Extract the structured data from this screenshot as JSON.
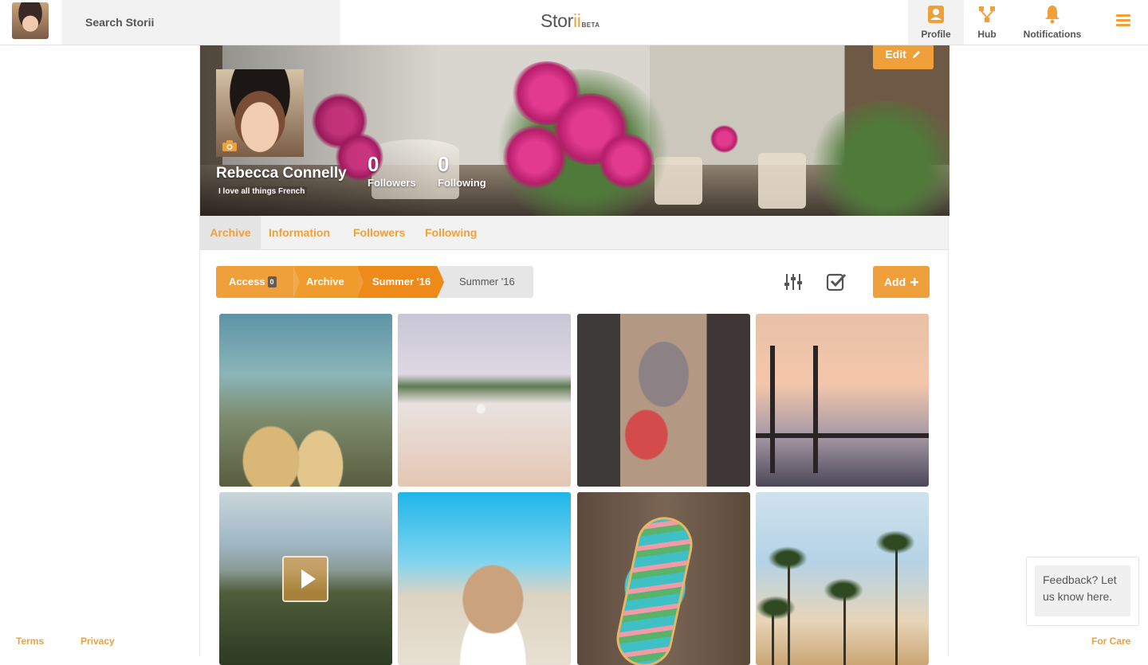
{
  "topbar": {
    "search_placeholder": "Search Storii",
    "logo_main": "Stor",
    "logo_accent": "ii",
    "logo_beta": "BETA",
    "nav": {
      "profile": "Profile",
      "hub": "Hub",
      "notifications": "Notifications"
    }
  },
  "profile": {
    "name": "Rebecca Connelly",
    "bio": "I love all things French",
    "followers_count": "0",
    "followers_label": "Followers",
    "following_count": "0",
    "following_label": "Following",
    "edit_label": "Edit"
  },
  "tabs": [
    "Archive",
    "Information",
    "Followers",
    "Following"
  ],
  "breadcrumb": {
    "access_label": "Access",
    "access_badge": "0",
    "items": [
      "Archive",
      "Summer '16",
      "Summer '16"
    ]
  },
  "toolbar": {
    "add_label": "Add"
  },
  "photos": [
    {
      "subject": "friends-by-sea"
    },
    {
      "subject": "beach-runner"
    },
    {
      "subject": "watermelon"
    },
    {
      "subject": "lifeguard-tower"
    },
    {
      "subject": "city-video",
      "is_video": true
    },
    {
      "subject": "woman-beach"
    },
    {
      "subject": "skateboard"
    },
    {
      "subject": "palm-trees"
    }
  ],
  "footer": {
    "terms": "Terms",
    "privacy": "Privacy",
    "for_care": "For Care"
  },
  "feedback": {
    "text": "Feedback? Let us know here."
  },
  "colors": {
    "accent": "#f0a03b",
    "text": "#4a4a4a"
  },
  "icons": [
    "search-icon",
    "profile-icon",
    "hub-icon",
    "bell-icon",
    "menu-icon",
    "pencil-icon",
    "camera-icon",
    "filter-sliders-icon",
    "checkbox-check-icon",
    "plus-icon",
    "play-icon"
  ]
}
